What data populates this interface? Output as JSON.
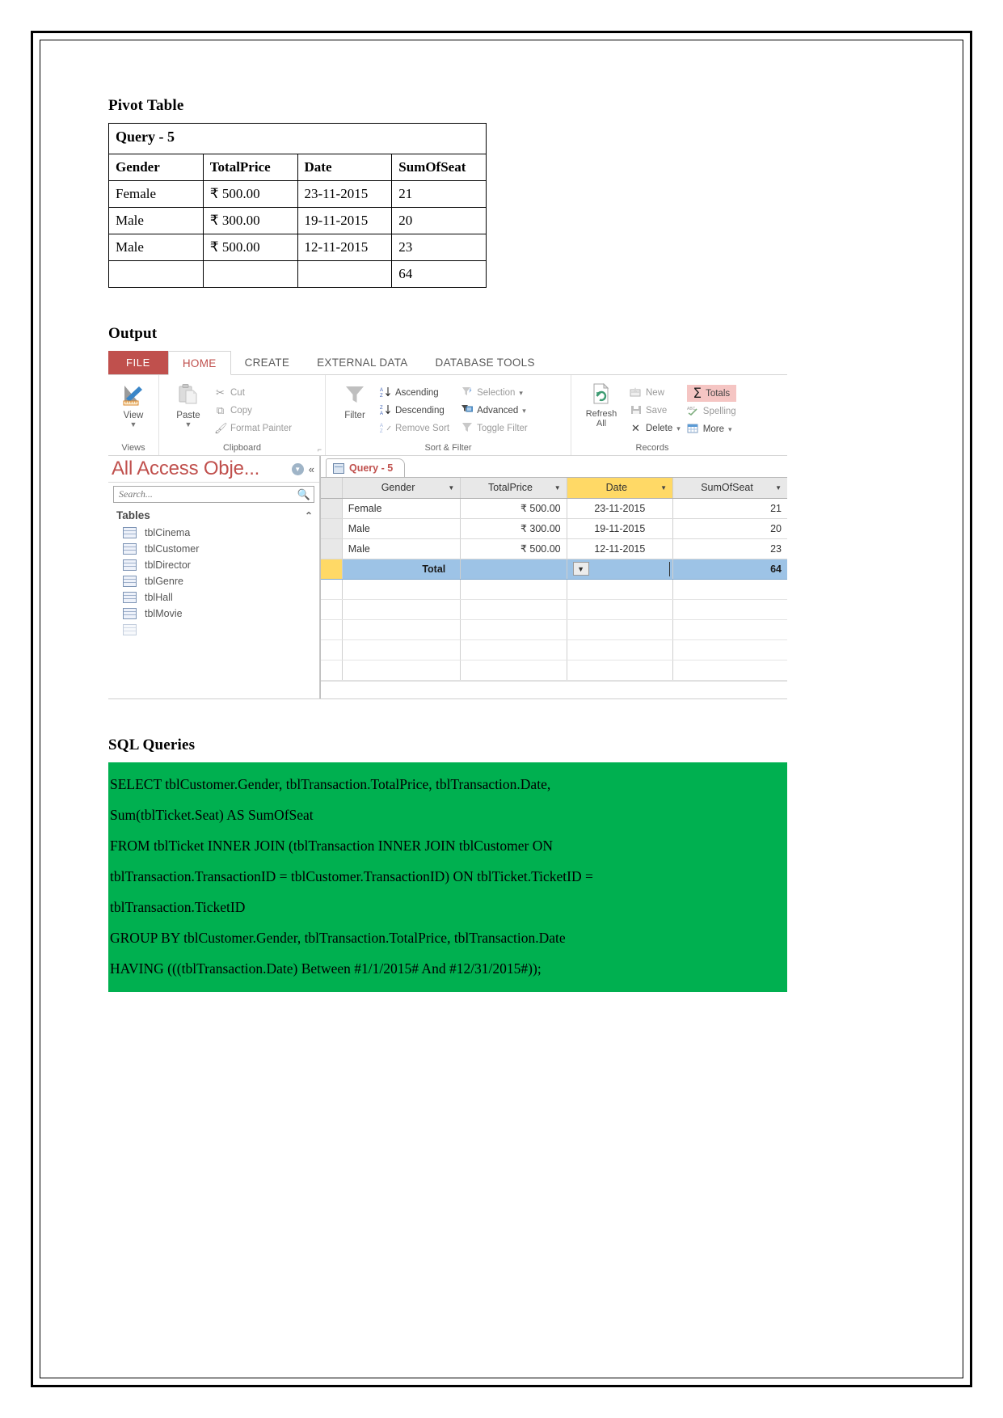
{
  "document": {
    "sections": {
      "pivot_heading": "Pivot Table",
      "output_heading": "Output",
      "sql_heading": "SQL Queries"
    }
  },
  "pivot_table": {
    "title": "Query - 5",
    "columns": [
      "Gender",
      "TotalPrice",
      "Date",
      "SumOfSeat"
    ],
    "rows": [
      [
        "Female",
        "₹ 500.00",
        "23-11-2015",
        "21"
      ],
      [
        "Male",
        "₹ 300.00",
        "19-11-2015",
        "20"
      ],
      [
        "Male",
        "₹ 500.00",
        "12-11-2015",
        "23"
      ],
      [
        "",
        "",
        "",
        "64"
      ]
    ]
  },
  "access": {
    "tabs": {
      "file": "FILE",
      "items": [
        "HOME",
        "CREATE",
        "EXTERNAL DATA",
        "DATABASE TOOLS"
      ],
      "active": "HOME"
    },
    "ribbon": {
      "groups": [
        {
          "name": "Views",
          "label": "Views",
          "buttons": [
            {
              "label": "View",
              "icon": "view-design-icon"
            }
          ]
        },
        {
          "name": "Clipboard",
          "label": "Clipboard",
          "buttons": [
            {
              "label": "Paste",
              "icon": "paste-icon"
            },
            {
              "label": "Cut",
              "icon": "scissors-icon"
            },
            {
              "label": "Copy",
              "icon": "copy-icon"
            },
            {
              "label": "Format Painter",
              "icon": "format-painter-icon"
            }
          ]
        },
        {
          "name": "Sort & Filter",
          "label": "Sort & Filter",
          "buttons": [
            {
              "label": "Filter",
              "icon": "funnel-icon"
            },
            {
              "label": "Ascending",
              "icon": "sort-az-icon"
            },
            {
              "label": "Descending",
              "icon": "sort-za-icon"
            },
            {
              "label": "Remove Sort",
              "icon": "remove-sort-icon"
            },
            {
              "label": "Selection",
              "icon": "selection-icon"
            },
            {
              "label": "Advanced",
              "icon": "advanced-filter-icon"
            },
            {
              "label": "Toggle Filter",
              "icon": "toggle-filter-icon"
            }
          ]
        },
        {
          "name": "Records",
          "label": "Records",
          "buttons": [
            {
              "label": "Refresh All",
              "icon": "refresh-icon"
            },
            {
              "label": "New",
              "icon": "new-record-icon"
            },
            {
              "label": "Save",
              "icon": "save-icon"
            },
            {
              "label": "Delete",
              "icon": "delete-icon"
            },
            {
              "label": "Totals",
              "icon": "sigma-icon"
            },
            {
              "label": "Spelling",
              "icon": "spelling-icon"
            },
            {
              "label": "More",
              "icon": "more-icon"
            }
          ]
        }
      ],
      "refresh_label_line1": "Refresh",
      "refresh_label_line2": "All",
      "view_label": "View",
      "paste_label": "Paste",
      "filter_label": "Filter"
    },
    "navigation_pane": {
      "title": "All Access Obje...",
      "search_placeholder": "Search...",
      "group_header": "Tables",
      "items": [
        "tblCinema",
        "tblCustomer",
        "tblDirector",
        "tblGenre",
        "tblHall",
        "tblMovie"
      ]
    },
    "datasheet": {
      "document_tab": "Query - 5",
      "columns": [
        "Gender",
        "TotalPrice",
        "Date",
        "SumOfSeat"
      ],
      "highlighted_column": "Date",
      "rows": [
        {
          "gender": "Female",
          "totalprice": "₹ 500.00",
          "date": "23-11-2015",
          "sumofseat": "21"
        },
        {
          "gender": "Male",
          "totalprice": "₹ 300.00",
          "date": "19-11-2015",
          "sumofseat": "20"
        },
        {
          "gender": "Male",
          "totalprice": "₹ 500.00",
          "date": "12-11-2015",
          "sumofseat": "23"
        }
      ],
      "total_row": {
        "label": "Total",
        "totalprice": "",
        "date": "",
        "sumofseat": "64"
      }
    },
    "colors": {
      "file_tab": "#c0504d",
      "active_tab_text": "#c0504d",
      "highlight_header": "#ffd966",
      "total_row": "#9dc3e6",
      "selection_border": "#d99694",
      "totals_button": "#f5c5c3"
    }
  },
  "sql": {
    "background_color": "#00b050",
    "lines": [
      "SELECT tblCustomer.Gender, tblTransaction.TotalPrice, tblTransaction.Date,",
      "Sum(tblTicket.Seat) AS SumOfSeat",
      "FROM tblTicket INNER JOIN (tblTransaction INNER JOIN tblCustomer ON",
      "tblTransaction.TransactionID = tblCustomer.TransactionID) ON tblTicket.TicketID =",
      "tblTransaction.TicketID",
      "GROUP BY tblCustomer.Gender, tblTransaction.TotalPrice, tblTransaction.Date",
      "HAVING (((tblTransaction.Date) Between #1/1/2015# And #12/31/2015#));"
    ]
  }
}
